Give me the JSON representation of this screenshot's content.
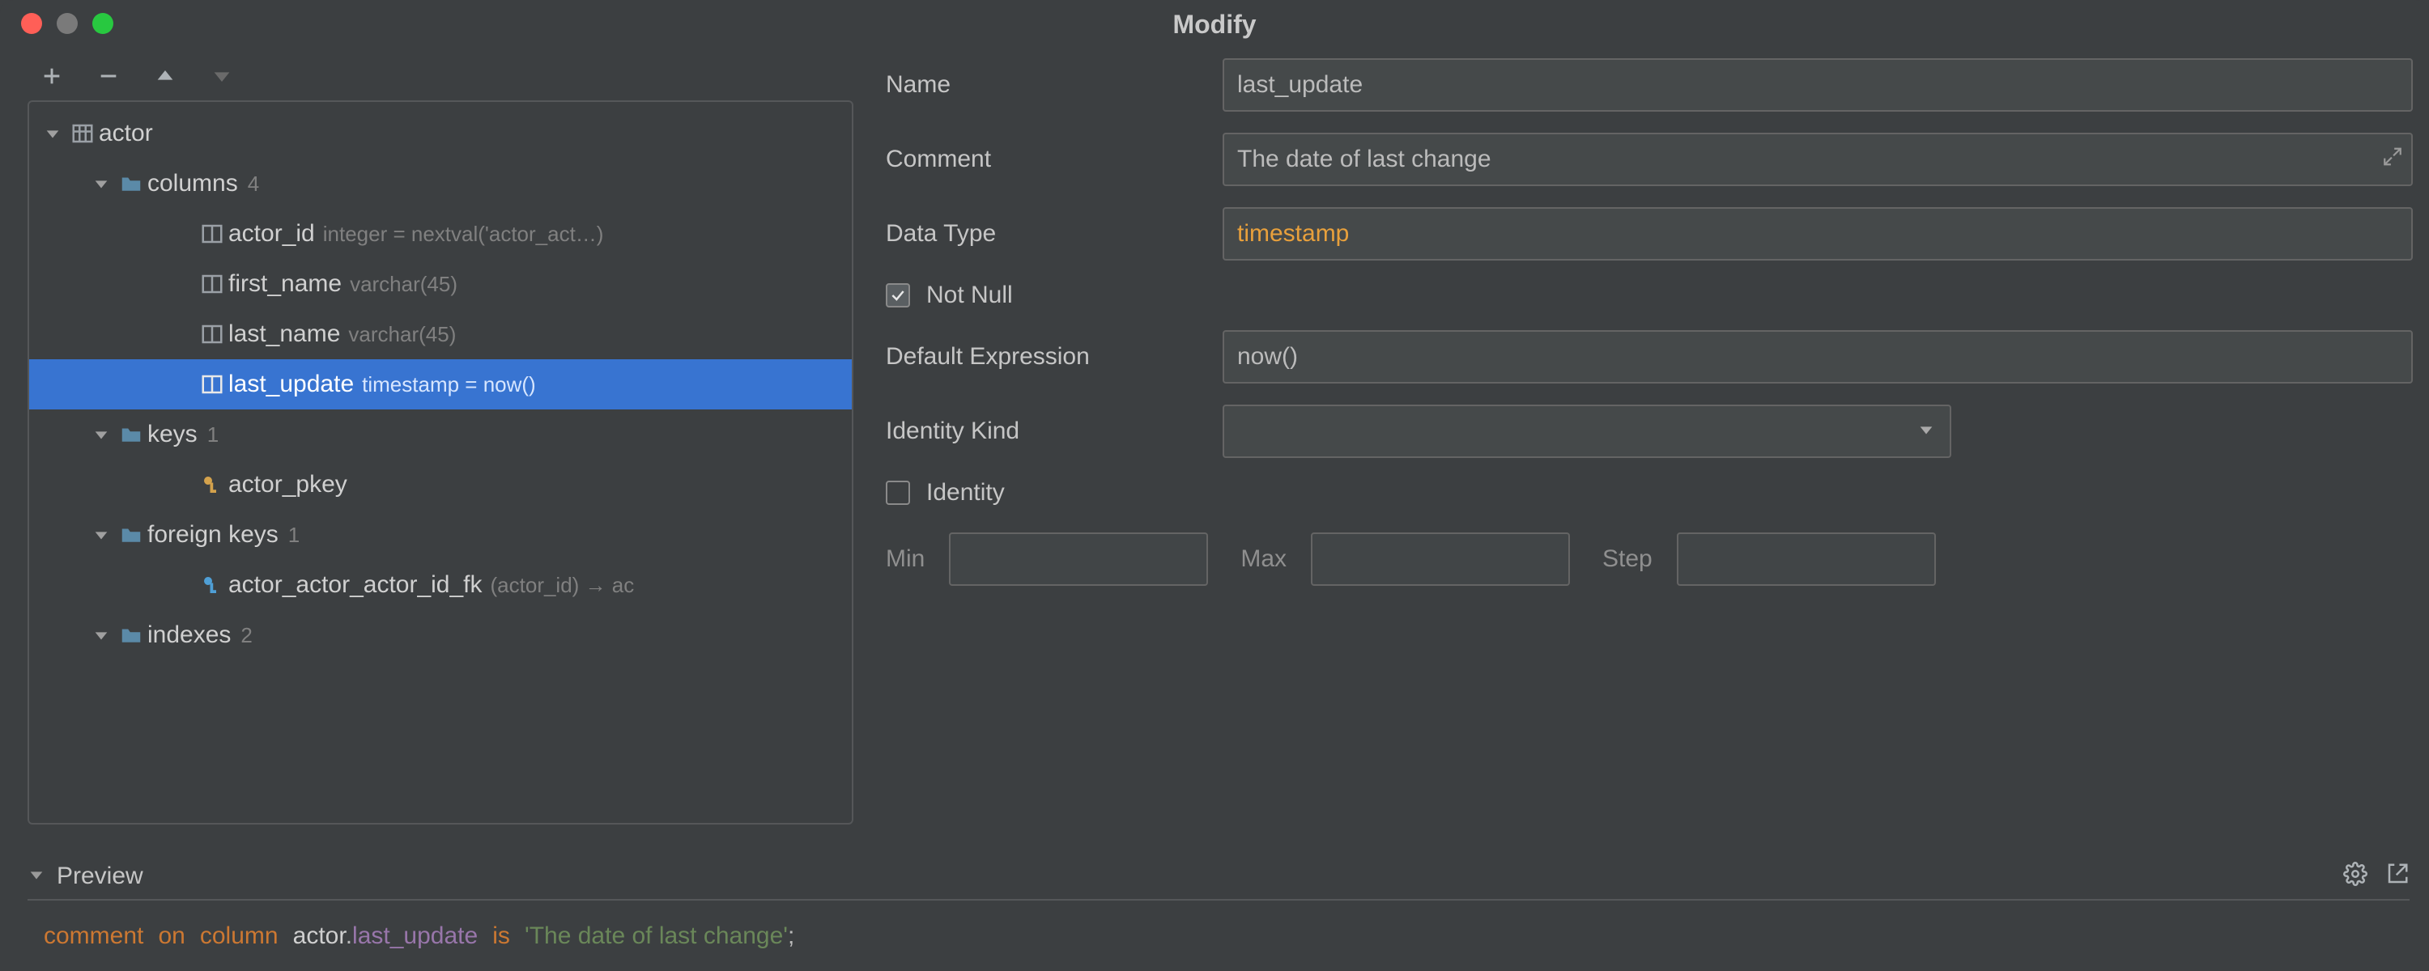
{
  "window": {
    "title": "Modify"
  },
  "toolbar": {
    "add_tip": "Add",
    "remove_tip": "Remove",
    "up_tip": "Move Up",
    "down_tip": "Move Down"
  },
  "tree": {
    "table": {
      "name": "actor"
    },
    "groups": {
      "columns": {
        "label": "columns",
        "count": "4"
      },
      "keys": {
        "label": "keys",
        "count": "1"
      },
      "fkeys": {
        "label": "foreign keys",
        "count": "1"
      },
      "indexes": {
        "label": "indexes",
        "count": "2"
      }
    },
    "columns": [
      {
        "name": "actor_id",
        "meta": "integer = nextval('actor_act…)"
      },
      {
        "name": "first_name",
        "meta": "varchar(45)"
      },
      {
        "name": "last_name",
        "meta": "varchar(45)"
      },
      {
        "name": "last_update",
        "meta": "timestamp = now()"
      }
    ],
    "keys": [
      {
        "name": "actor_pkey"
      }
    ],
    "fkeys": [
      {
        "name": "actor_actor_actor_id_fk",
        "meta": "(actor_id) → ac"
      }
    ]
  },
  "form": {
    "name": {
      "label": "Name",
      "value": "last_update"
    },
    "comment": {
      "label": "Comment",
      "value": "The date of last change"
    },
    "datatype": {
      "label": "Data Type",
      "value": "timestamp"
    },
    "notnull": {
      "label": "Not Null",
      "checked": true
    },
    "default_expr": {
      "label": "Default Expression",
      "value": "now()"
    },
    "identity_kind": {
      "label": "Identity Kind",
      "value": ""
    },
    "identity": {
      "label": "Identity",
      "checked": false
    },
    "min": {
      "label": "Min",
      "value": ""
    },
    "max": {
      "label": "Max",
      "value": ""
    },
    "step": {
      "label": "Step",
      "value": ""
    }
  },
  "preview": {
    "title": "Preview",
    "sql_tokens": {
      "kw_comment": "comment",
      "kw_on": "on",
      "kw_column": "column",
      "tbl": "actor",
      "dot": ".",
      "col": "last_update",
      "kw_is": "is",
      "str": "'The date of last change'",
      "semi": ";"
    }
  }
}
